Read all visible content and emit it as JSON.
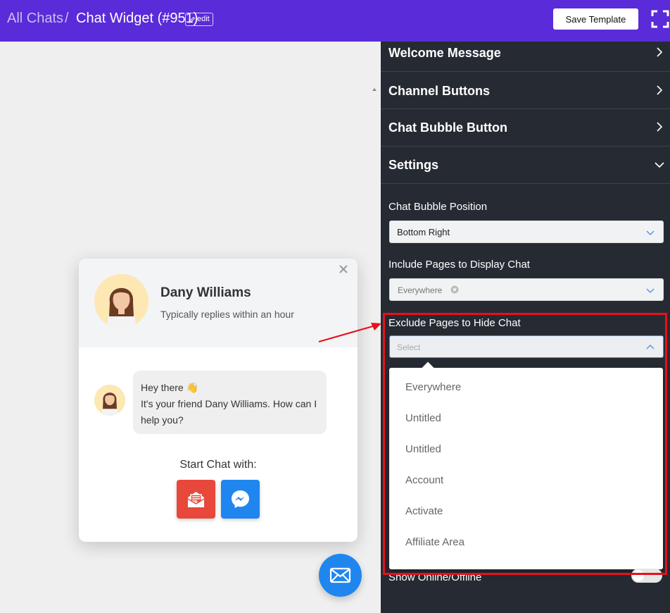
{
  "header": {
    "breadcrumb_root": "All Chats",
    "breadcrumb_separator": "/",
    "breadcrumb_current": "Chat Widget (#951)",
    "edit_label": "edit",
    "save_label": "Save Template",
    "brand_color": "#5a2bd8"
  },
  "preview": {
    "agent_name": "Dany Williams",
    "agent_subtitle": "Typically replies within an hour",
    "message_line1": "Hey there 👋",
    "message_line2": "It's your friend Dany Williams. How can I help you?",
    "start_chat_label": "Start Chat with:",
    "channels": [
      "email",
      "messenger"
    ],
    "fab_icon": "mail-icon"
  },
  "panel": {
    "sections": [
      {
        "title": "Welcome Message",
        "state": "collapsed"
      },
      {
        "title": "Channel Buttons",
        "state": "collapsed"
      },
      {
        "title": "Chat Bubble Button",
        "state": "collapsed"
      },
      {
        "title": "Settings",
        "state": "expanded"
      }
    ],
    "bubble_position_label": "Chat Bubble Position",
    "bubble_position_value": "Bottom Right",
    "include_label": "Include Pages to Display Chat",
    "include_value": "Everywhere",
    "exclude_label": "Exclude Pages to Hide Chat",
    "exclude_placeholder": "Select",
    "exclude_options": [
      "Everywhere",
      "Untitled",
      "Untitled",
      "Account",
      "Activate",
      "Affiliate Area"
    ],
    "online_label": "Show Online/Offline"
  }
}
